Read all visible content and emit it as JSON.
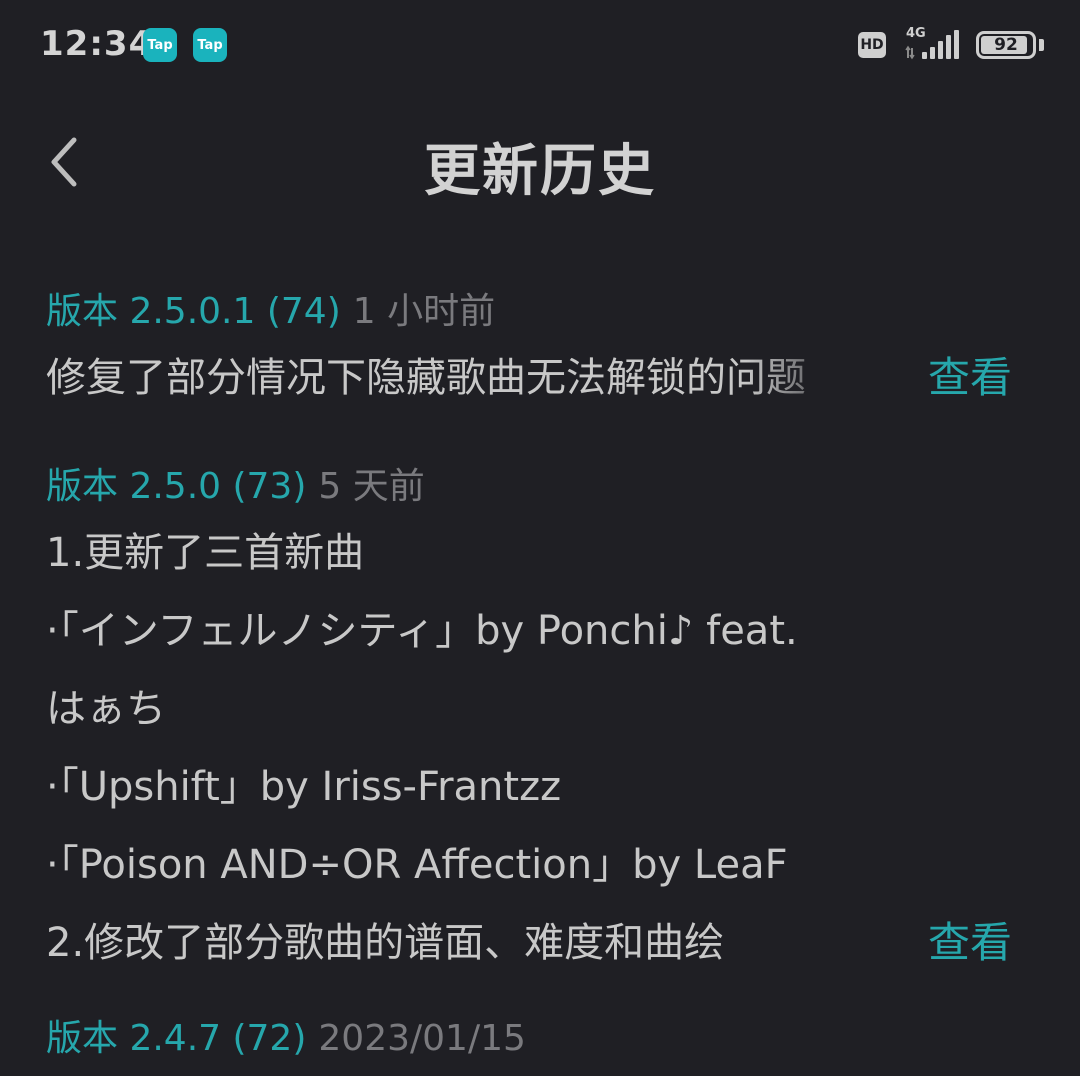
{
  "status_bar": {
    "time": "12:34",
    "notification_icons": [
      "Tap",
      "Tap"
    ],
    "hd_label": "HD",
    "network_label": "4G",
    "battery_percent": "92",
    "battery_level": 0.92,
    "icons": [
      "tap-app-icon",
      "hd-voice-icon",
      "signal-icon",
      "battery-icon"
    ]
  },
  "header": {
    "title": "更新历史",
    "back_icon": "chevron-left-icon"
  },
  "versions": [
    {
      "label": "版本 2.5.0.1 (74)",
      "time": "1 小时前",
      "lines": [],
      "summary": "修复了部分情况下隐藏歌曲无法解锁的问题",
      "action": "查看"
    },
    {
      "label": "版本 2.5.0 (73)",
      "time": "5 天前",
      "lines": [
        "1.更新了三首新曲",
        " ·「インフェルノシティ」by Ponchi♪ feat.",
        "はぁち",
        " ·「Upshift」by Iriss-Frantzz",
        " ·「Poison AND÷OR Affection」by LeaF"
      ],
      "summary": "2.修改了部分歌曲的谱面、难度和曲绘",
      "action": "查看"
    },
    {
      "label": "版本 2.4.7 (72)",
      "time": "2023/01/15",
      "lines": [],
      "summary": "",
      "action": ""
    }
  ],
  "colors": {
    "background": "#1f1f24",
    "accent": "#26a7ac",
    "text": "#c8c8c8",
    "muted": "#7a7a7e",
    "tap_badge": "#1ab3bd"
  }
}
